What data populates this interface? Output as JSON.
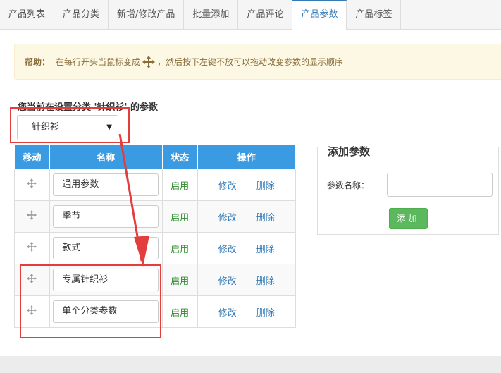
{
  "tabs": [
    {
      "label": "产品列表",
      "active": false
    },
    {
      "label": "产品分类",
      "active": false
    },
    {
      "label": "新增/修改产品",
      "active": false
    },
    {
      "label": "批量添加",
      "active": false
    },
    {
      "label": "产品评论",
      "active": false
    },
    {
      "label": "产品参数",
      "active": true
    },
    {
      "label": "产品标签",
      "active": false
    }
  ],
  "help": {
    "label": "帮助：",
    "text_before": "在每行开头当鼠标变成",
    "text_after": "，然后按下左键不放可以拖动改变参数的显示顺序"
  },
  "current_category_text": "您当前在设置分类 '针织衫' 的参数",
  "category_select": {
    "value": "针织衫"
  },
  "table": {
    "headers": {
      "move": "移动",
      "name": "名称",
      "status": "状态",
      "ops": "操作"
    },
    "rows": [
      {
        "name": "通用参数",
        "status": "启用",
        "edit": "修改",
        "delete": "删除"
      },
      {
        "name": "季节",
        "status": "启用",
        "edit": "修改",
        "delete": "删除"
      },
      {
        "name": "款式",
        "status": "启用",
        "edit": "修改",
        "delete": "删除"
      },
      {
        "name": "专属针织衫",
        "status": "启用",
        "edit": "修改",
        "delete": "删除"
      },
      {
        "name": "单个分类参数",
        "status": "启用",
        "edit": "修改",
        "delete": "删除"
      }
    ]
  },
  "add_panel": {
    "title": "添加参数",
    "field_label": "参数名称：",
    "button_label": "添加"
  },
  "colors": {
    "header_blue": "#3a9be2",
    "annotation_red": "#e43d3d",
    "button_green": "#5cb85c",
    "link_blue": "#337ab7",
    "status_green": "#2a8a2a"
  }
}
